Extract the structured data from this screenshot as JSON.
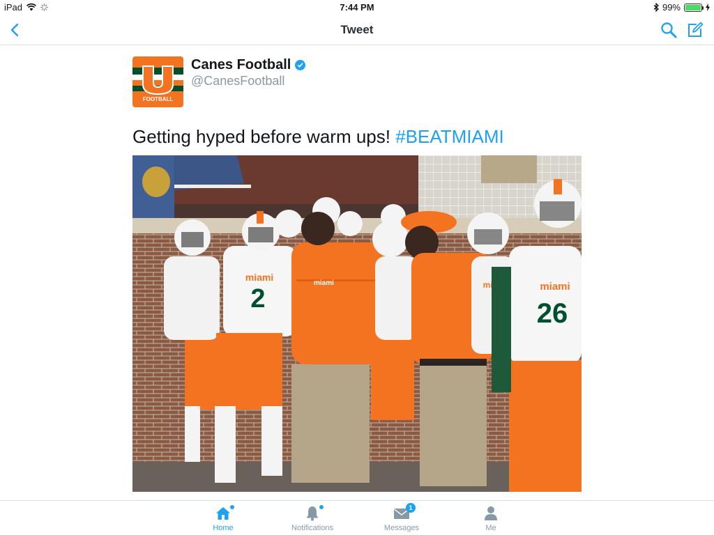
{
  "status_bar": {
    "device": "iPad",
    "time": "7:44 PM",
    "battery": "99%",
    "battery_level": 0.99
  },
  "nav": {
    "title": "Tweet",
    "back_icon": "chevron-left-icon",
    "search_icon": "search-icon",
    "compose_icon": "compose-icon"
  },
  "tweet": {
    "author_name": "Canes Football",
    "verified": true,
    "author_handle": "@CanesFootball",
    "avatar_text": "FOOTBALL",
    "text": "Getting hyped before warm ups! ",
    "hashtag": "#BEATMIAMI",
    "photo": {
      "jersey_texts": [
        "miami",
        "2",
        "miami",
        "26",
        "miami",
        "miami"
      ]
    }
  },
  "tabs": [
    {
      "label": "Home",
      "icon": "home-icon",
      "active": true,
      "dot": true
    },
    {
      "label": "Notifications",
      "icon": "bell-icon",
      "active": false,
      "dot": true
    },
    {
      "label": "Messages",
      "icon": "envelope-icon",
      "active": false,
      "badge": "1"
    },
    {
      "label": "Me",
      "icon": "person-icon",
      "active": false
    }
  ],
  "colors": {
    "accent": "#1da1f2",
    "miami_orange": "#f47321",
    "miami_green": "#005030"
  }
}
